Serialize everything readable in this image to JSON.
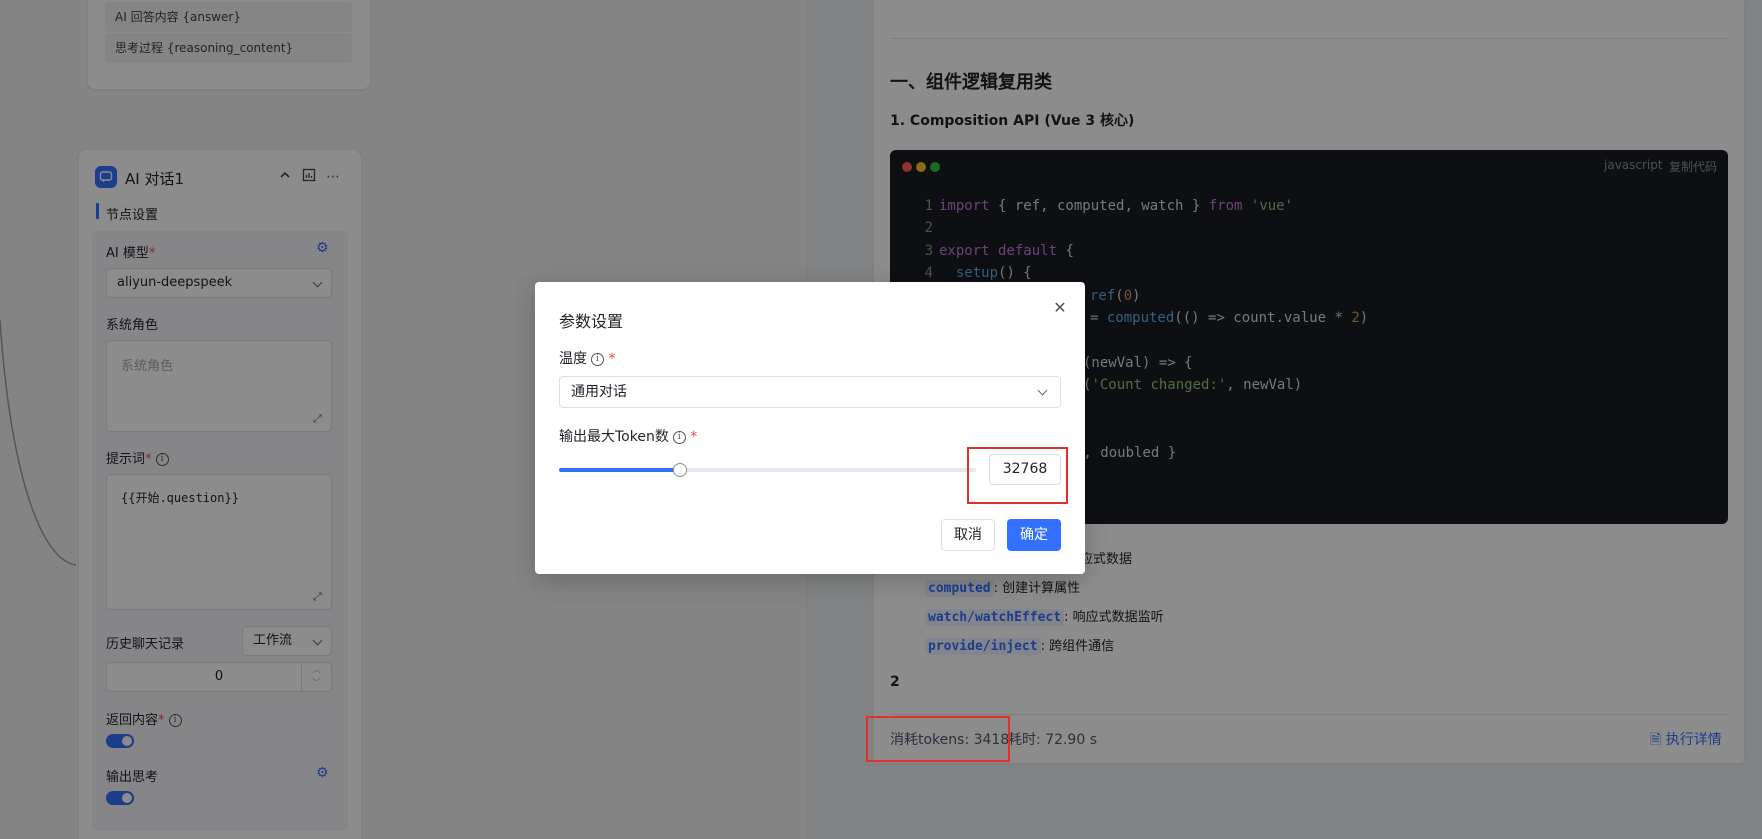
{
  "canvas": {
    "top_card": {
      "outputs": [
        "AI 回答内容 {answer}",
        "思考过程 {reasoning_content}"
      ]
    },
    "node": {
      "title": "AI 对话1",
      "section_title": "节点设置",
      "model_label": "AI 模型",
      "model_value": "aliyun-deepspeek",
      "system_role_label": "系统角色",
      "system_role_placeholder": "系统角色",
      "prompt_label": "提示词",
      "prompt_value": "{{开始.question}}",
      "history_label": "历史聊天记录",
      "history_select": "工作流",
      "history_count": "0",
      "return_label": "返回内容",
      "output_thinking_label": "输出思考"
    }
  },
  "doc": {
    "heading": "一、组件逻辑复用类",
    "subheading": "1. Composition API (Vue 3 核心)",
    "code": {
      "language": "javascript",
      "copy_label": "复制代码",
      "line_numbers": [
        "1",
        "2",
        "3",
        "4"
      ]
    },
    "bullets": [
      {
        "text": "应式数据"
      },
      {
        "code": "computed",
        "text": ": 创建计算属性"
      },
      {
        "code": "watch/watchEffect",
        "text": ": 响应式数据监听"
      },
      {
        "code": "provide/inject",
        "text": ": 跨组件通信"
      }
    ],
    "section_number": "2",
    "footer": {
      "tokens": "消耗tokens: 3418",
      "elapsed": "耗时: 72.90 s",
      "detail_link": "执行详情"
    }
  },
  "modal": {
    "title": "参数设置",
    "temperature_label": "温度",
    "temperature_value": "通用对话",
    "max_token_label": "输出最大Token数",
    "max_token_value": "32768",
    "slider_fraction": 0.29,
    "cancel_label": "取消",
    "ok_label": "确定"
  },
  "colors": {
    "accent": "#3370ff",
    "highlight": "#e0312b",
    "code_bg": "#181c24"
  }
}
